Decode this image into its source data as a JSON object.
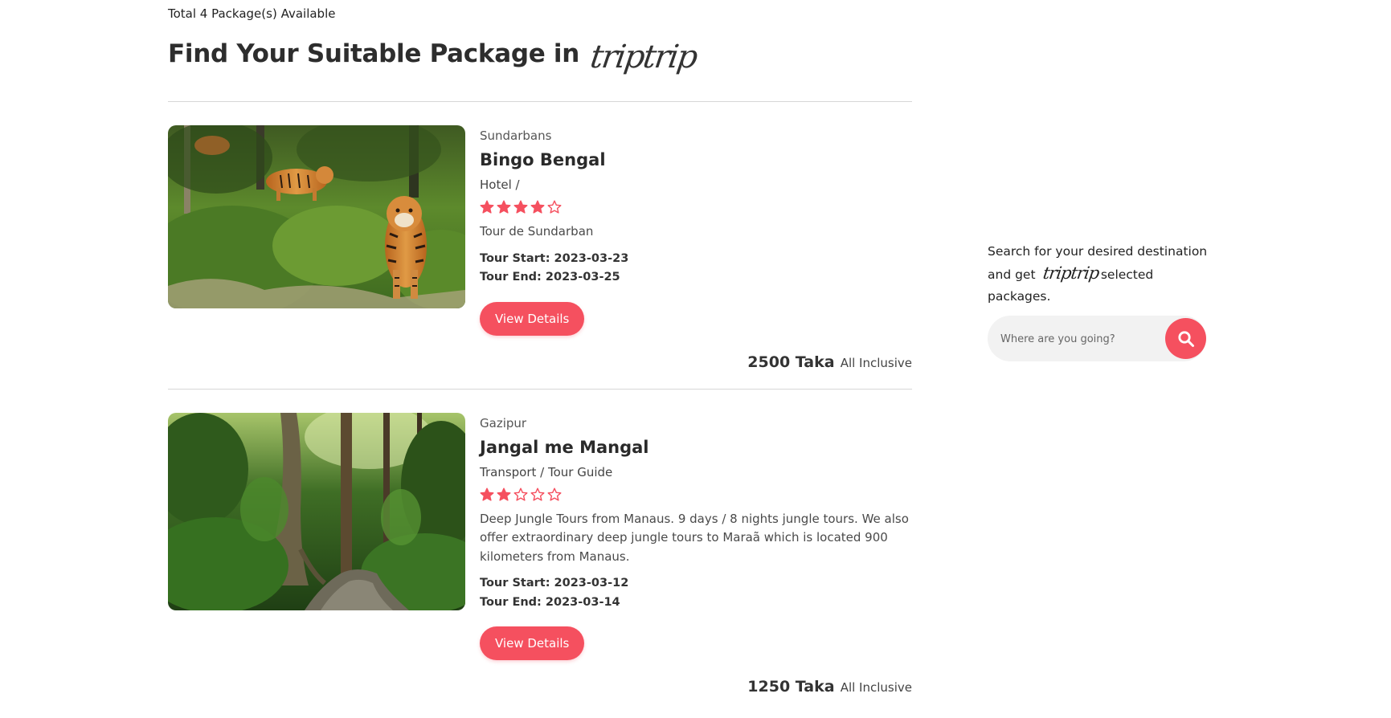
{
  "header": {
    "total_text": "Total 4 Package(s) Available",
    "heading": "Find Your Suitable Package in",
    "logo_text": "triptrip"
  },
  "packages": [
    {
      "location": "Sundarbans",
      "title": "Bingo Bengal",
      "services": "Hotel /",
      "rating": 4,
      "rating_max": 5,
      "description": "Tour de Sundarban",
      "tour_start": "Tour Start: 2023-03-23",
      "tour_end": "Tour End: 2023-03-25",
      "button_label": "View Details",
      "price": "2500 Taka",
      "price_note": "All Inclusive"
    },
    {
      "location": "Gazipur",
      "title": "Jangal me Mangal",
      "services": "Transport / Tour Guide",
      "rating": 2,
      "rating_max": 5,
      "description": "Deep Jungle Tours from Manaus. 9 days / 8 nights jungle tours. We also offer extraordinary deep jungle tours to Maraã which is located 900 kilometers from Manaus.",
      "tour_start": "Tour Start: 2023-03-12",
      "tour_end": "Tour End: 2023-03-14",
      "button_label": "View Details",
      "price": "1250 Taka",
      "price_note": "All Inclusive"
    }
  ],
  "sidebar": {
    "text_line1": "Search for your desired destination",
    "text_prefix": "and get",
    "logo_text": "triptrip",
    "text_suffix": "selected packages.",
    "search_placeholder": "Where are you going?"
  },
  "colors": {
    "accent": "#f5505f",
    "search_bg": "#f2f2f2",
    "divider": "#d7d7d7"
  },
  "icons": {
    "star_filled": "star-filled-icon",
    "star_empty": "star-outline-icon",
    "search": "search-icon"
  }
}
